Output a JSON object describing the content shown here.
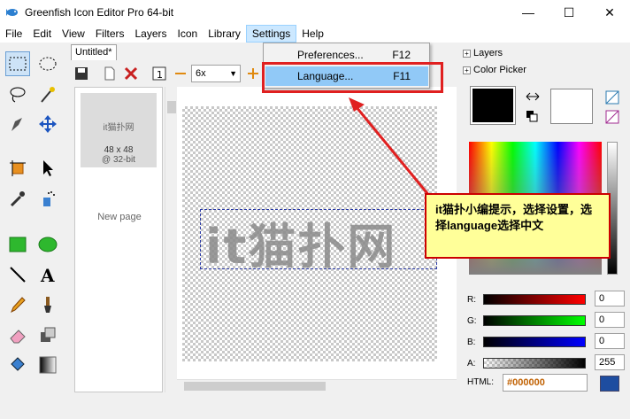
{
  "window": {
    "title": "Greenfish Icon Editor Pro 64-bit",
    "minimize": "—",
    "maximize": "☐",
    "close": "✕"
  },
  "menubar": {
    "items": [
      "File",
      "Edit",
      "View",
      "Filters",
      "Layers",
      "Icon",
      "Library",
      "Settings",
      "Help"
    ]
  },
  "settings_menu": {
    "items": [
      {
        "label": "Preferences...",
        "shortcut": "F12"
      },
      {
        "label": "Language...",
        "shortcut": "F11"
      }
    ]
  },
  "document": {
    "tab_label": "Untitled*",
    "zoom": "6x",
    "canvas_text": "it猫扑网"
  },
  "pages": {
    "thumb_title": "it猫扑网",
    "thumb_size": "48 x 48",
    "thumb_depth": "@ 32-bit",
    "new_page": "New page"
  },
  "right_panel": {
    "layers": "Layers",
    "color_picker": "Color Picker",
    "channels": [
      {
        "label": "R:",
        "value": "0",
        "color": "#ff0000"
      },
      {
        "label": "G:",
        "value": "0",
        "color": "#00ff00"
      },
      {
        "label": "B:",
        "value": "0",
        "color": "#0000ff"
      },
      {
        "label": "A:",
        "value": "255",
        "color": "#000000"
      }
    ],
    "html_label": "HTML:",
    "html_value": "#000000"
  },
  "callout": {
    "text": "it猫扑小编提示，选择设置，选择language选择中文"
  }
}
